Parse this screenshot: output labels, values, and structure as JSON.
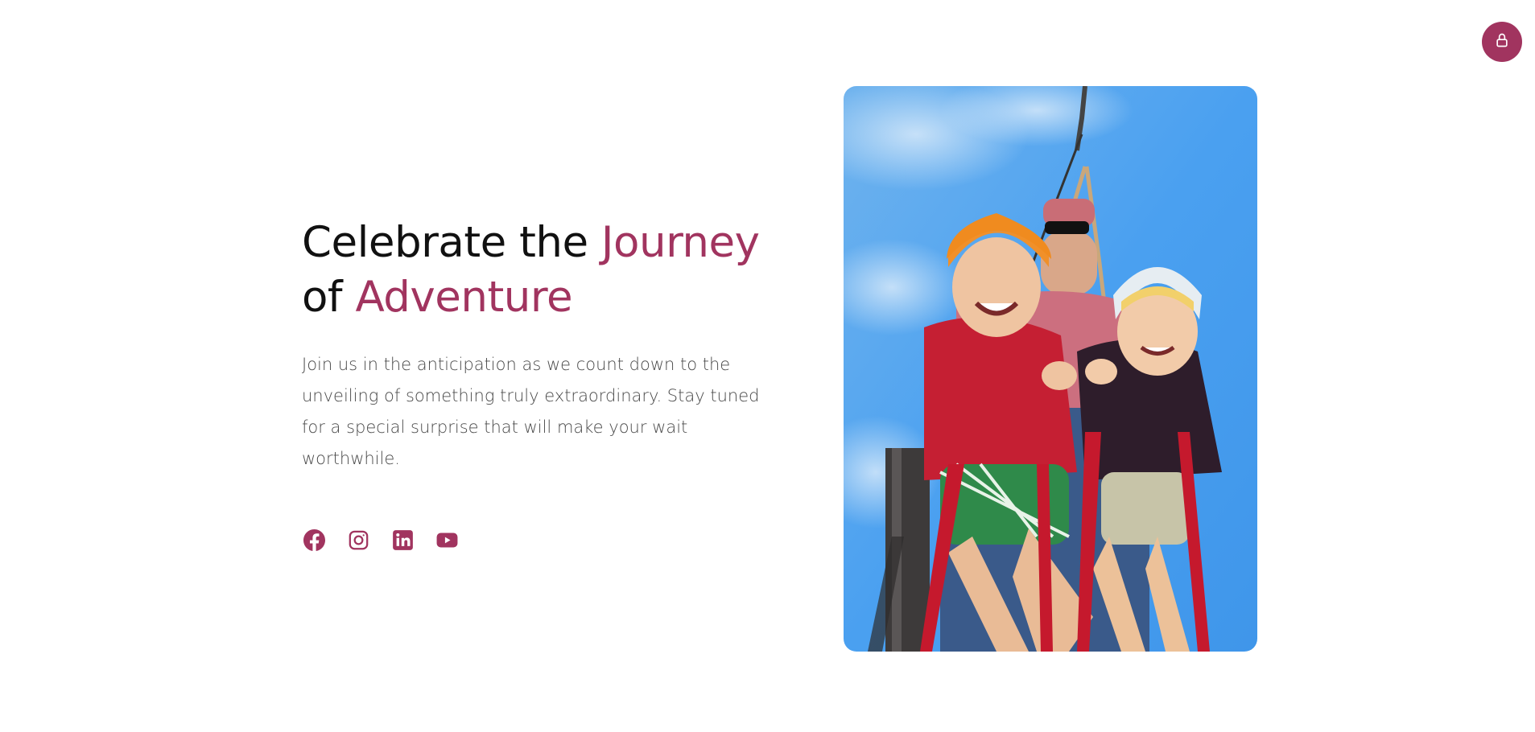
{
  "header": {
    "lock_button": {
      "icon": "lock-icon",
      "color": "#a1345f"
    }
  },
  "hero": {
    "title_part1": "Celebrate the ",
    "title_accent1": "Journey",
    "title_part2": "of ",
    "title_accent2": "Adventure",
    "description": "Join us in the anticipation as we count down to the unveiling of something truly extraordinary. Stay tuned for a special surprise that will make your wait worthwhile.",
    "accent_color": "#a1345f"
  },
  "socials": [
    {
      "icon": "facebook-icon"
    },
    {
      "icon": "instagram-icon"
    },
    {
      "icon": "linkedin-icon"
    },
    {
      "icon": "youtube-icon"
    }
  ],
  "image": {
    "subject": "two children on a zip line wearing helmets and red harnesses"
  }
}
